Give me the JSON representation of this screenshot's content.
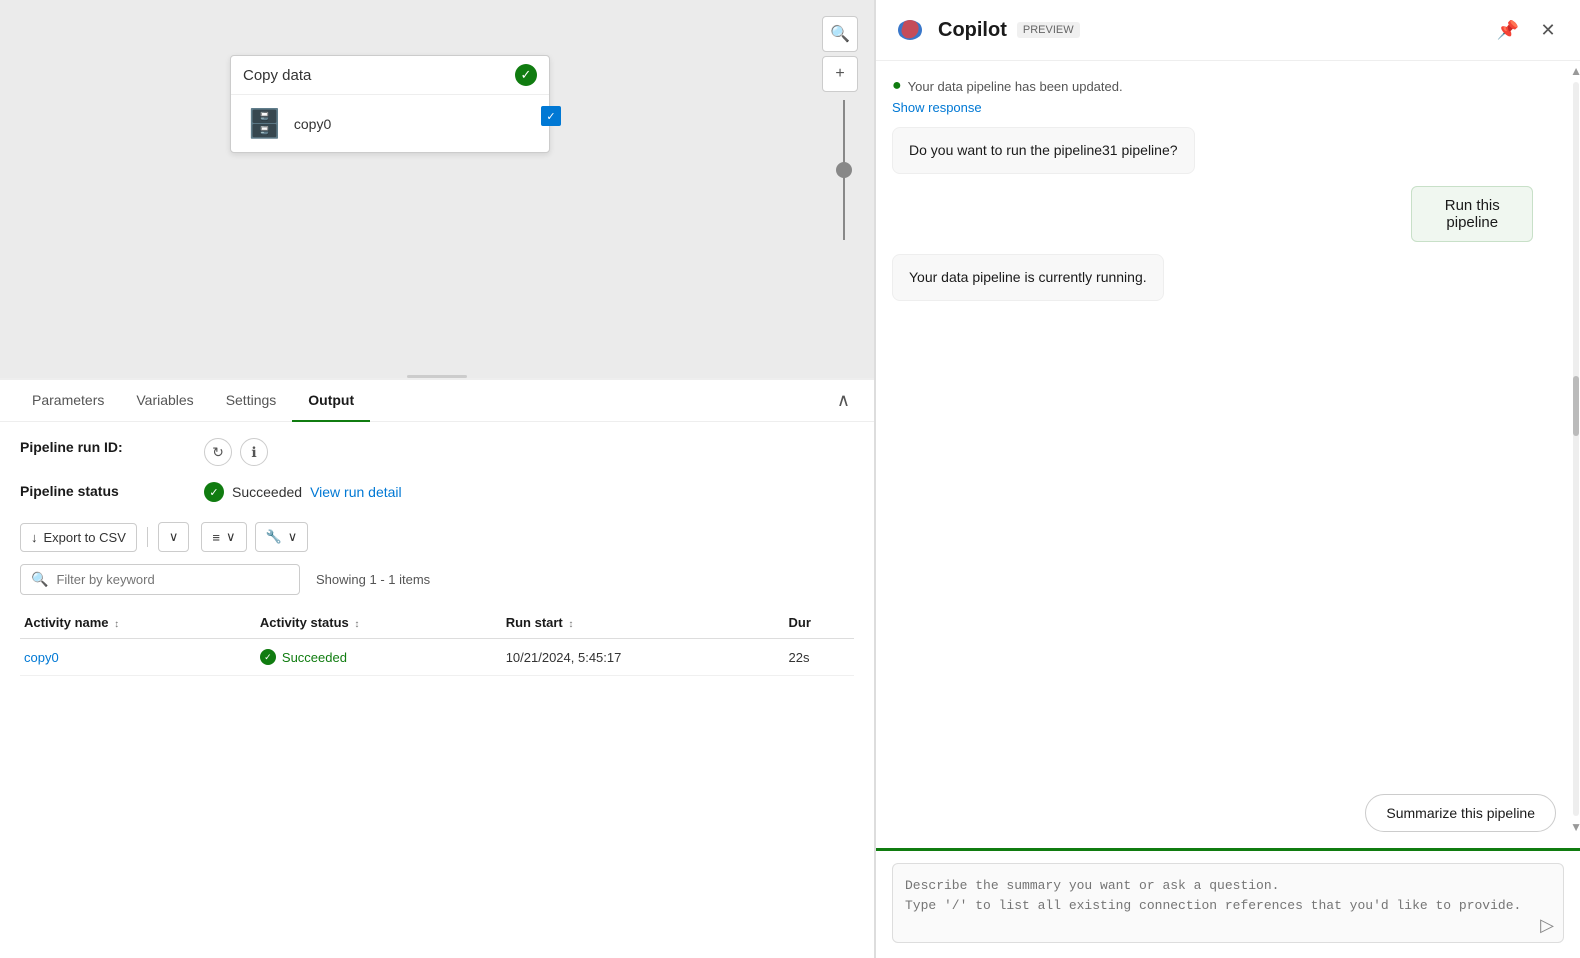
{
  "canvas": {
    "node": {
      "title": "Copy data",
      "activity_name": "copy0"
    },
    "zoom_btn": "+",
    "search_btn": "🔍"
  },
  "tabs": {
    "items": [
      {
        "label": "Parameters",
        "active": false
      },
      {
        "label": "Variables",
        "active": false
      },
      {
        "label": "Settings",
        "active": false
      },
      {
        "label": "Output",
        "active": true
      }
    ],
    "collapse_icon": "∧"
  },
  "output": {
    "pipeline_run_id_label": "Pipeline run ID:",
    "pipeline_status_label": "Pipeline status",
    "pipeline_status_value": "Succeeded",
    "view_run_link": "View run detail",
    "export_label": "Export to CSV",
    "filter_placeholder": "Filter by keyword",
    "showing_text": "Showing 1 - 1 items",
    "columns": [
      {
        "label": "Activity name",
        "sortable": true
      },
      {
        "label": "Activity status",
        "sortable": true
      },
      {
        "label": "Run start",
        "sortable": true
      },
      {
        "label": "Dur",
        "sortable": false
      }
    ],
    "rows": [
      {
        "activity_name": "copy0",
        "activity_status": "Succeeded",
        "run_start": "10/21/2024, 5:45:17",
        "duration": "22s"
      }
    ]
  },
  "copilot": {
    "title": "Copilot",
    "preview_label": "PREVIEW",
    "messages": [
      {
        "type": "assistant-status",
        "status_text": "Your data pipeline has been updated.",
        "show_response": "Show response"
      },
      {
        "type": "assistant",
        "text": "Do you want to run the pipeline31 pipeline?"
      },
      {
        "type": "user-action",
        "text": "Run this pipeline"
      },
      {
        "type": "assistant",
        "text": "Your data pipeline is currently running."
      }
    ],
    "summarize_btn": "Summarize this pipeline",
    "input_placeholder": "Describe the summary you want or ask a question.\nType '/' to list all existing connection references that you'd like to provide.",
    "send_icon": "▷"
  }
}
